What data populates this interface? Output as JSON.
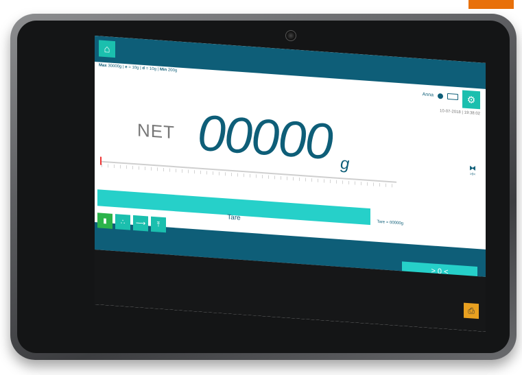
{
  "specs": {
    "max_label": "Max",
    "max_value": "30000g",
    "e_label": "e",
    "e_value": "= 10g",
    "d_label": "d",
    "d_value": "= 10g",
    "min_label": "Min",
    "min_value": "200g"
  },
  "user": {
    "name": "Anna"
  },
  "datetime": "10-07-2018 | 19:38:02",
  "display": {
    "net_label": "NET",
    "reading": "00000",
    "unit": "g",
    "zero_indicator": ">0<"
  },
  "tare_info": "Tare = 00000g",
  "buttons": {
    "tare": "Tare",
    "zero": "> 0 <"
  },
  "colors": {
    "primary": "#0e5e78",
    "accent": "#1bbfae",
    "button": "#26d0c9",
    "green": "#2bb34a",
    "orange": "#e8a020",
    "corner_tab": "#e8700a"
  },
  "icons": [
    "home-icon",
    "user-icon",
    "battery-icon",
    "settings-icon",
    "bar-chart-icon",
    "stack-icon",
    "formula-icon",
    "upload-icon",
    "printer-icon",
    "zero-indicator-icon"
  ]
}
